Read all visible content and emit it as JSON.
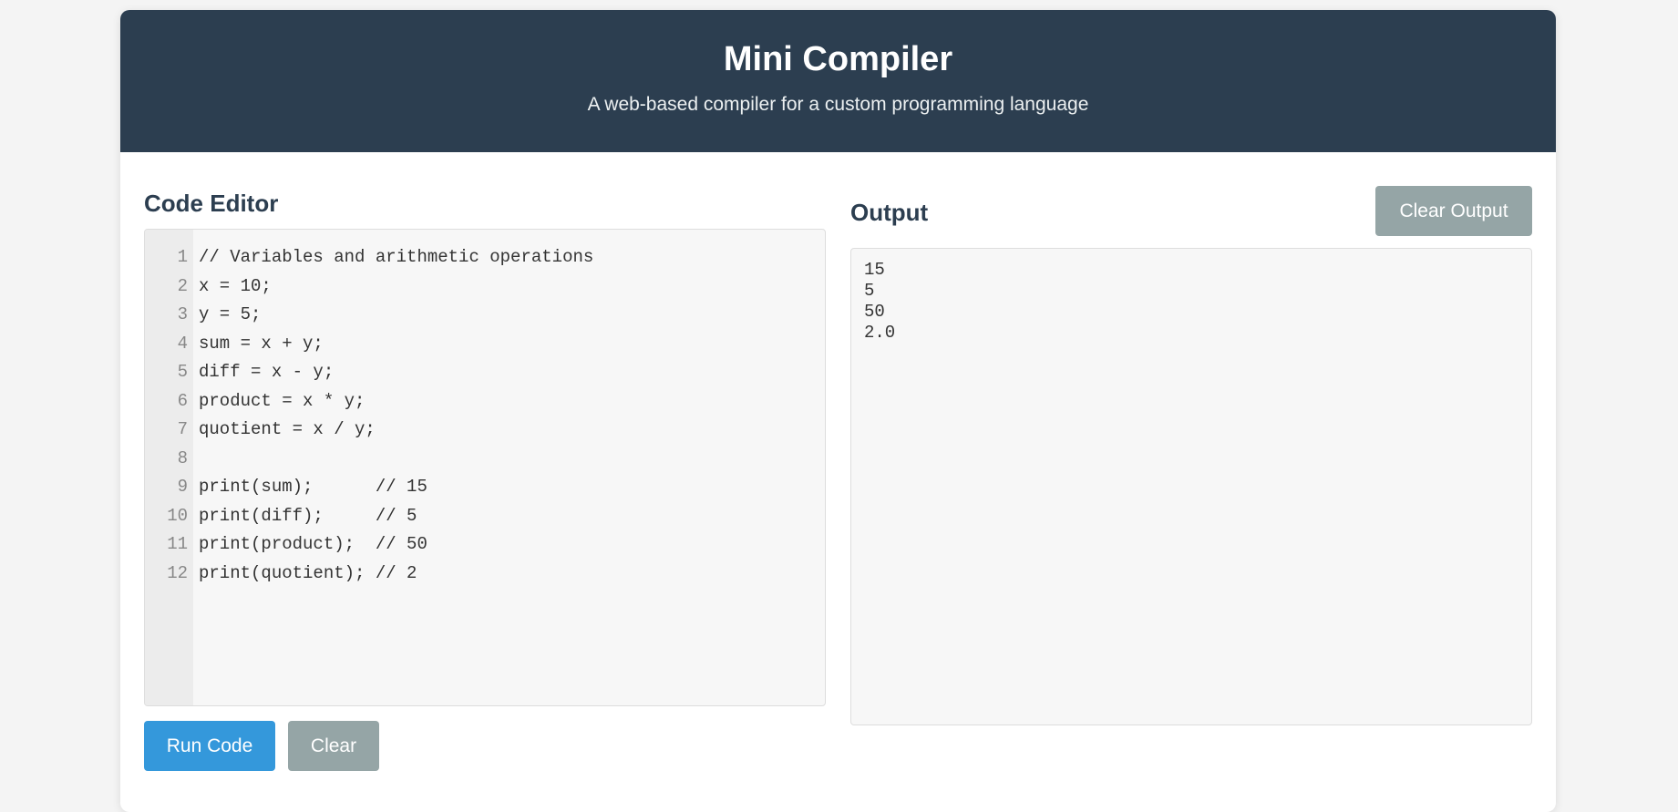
{
  "header": {
    "title": "Mini Compiler",
    "subtitle": "A web-based compiler for a custom programming language"
  },
  "editor": {
    "heading": "Code Editor",
    "line_numbers": [
      "1",
      "2",
      "3",
      "4",
      "5",
      "6",
      "7",
      "8",
      "9",
      "10",
      "11",
      "12"
    ],
    "lines": [
      "// Variables and arithmetic operations",
      "x = 10;",
      "y = 5;",
      "sum = x + y;",
      "diff = x - y;",
      "product = x * y;",
      "quotient = x / y;",
      "",
      "print(sum);      // 15",
      "print(diff);     // 5",
      "print(product);  // 50",
      "print(quotient); // 2"
    ],
    "run_label": "Run Code",
    "clear_label": "Clear"
  },
  "output": {
    "heading": "Output",
    "clear_label": "Clear Output",
    "lines": [
      "15",
      "5",
      "50",
      "2.0"
    ]
  },
  "colors": {
    "header_bg": "#2c3e50",
    "primary_button": "#3498db",
    "secondary_button": "#95a5a6"
  }
}
